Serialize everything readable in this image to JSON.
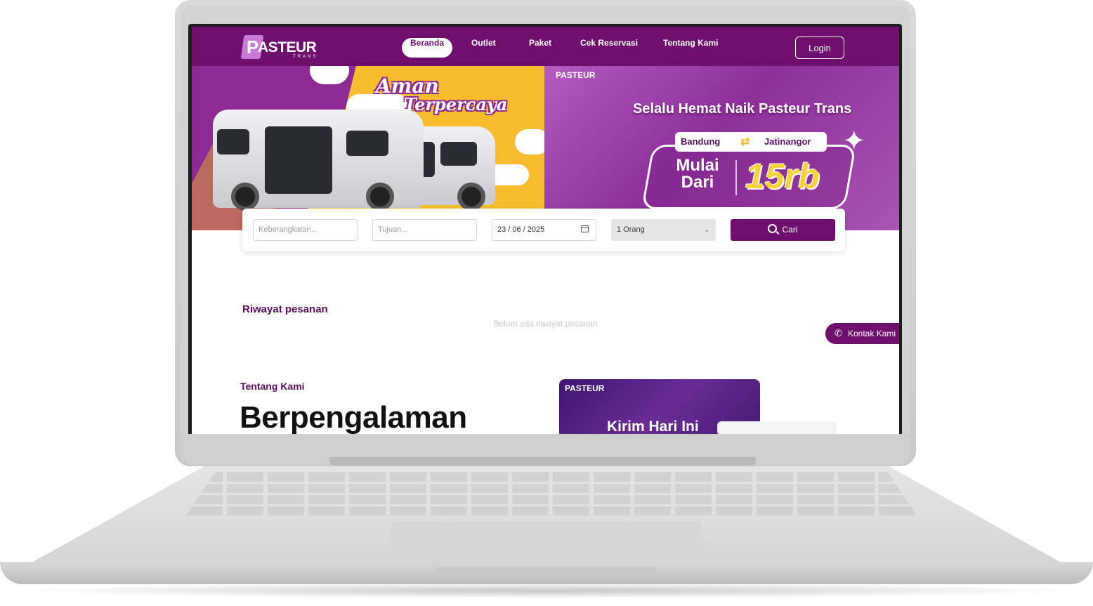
{
  "brand": {
    "name": "ASTEUR",
    "mark": "P",
    "tagline": "TRANS"
  },
  "nav": {
    "items": [
      {
        "label": "Beranda",
        "active": true
      },
      {
        "label": "Outlet"
      },
      {
        "label": "Paket"
      },
      {
        "label": "Cek Reservasi"
      },
      {
        "label": "Tentang Kami"
      }
    ],
    "login_label": "Login"
  },
  "hero": {
    "left": {
      "line1": "Aman",
      "line2": "Terpercaya"
    },
    "right": {
      "headline": "Selalu Hemat Naik Pasteur Trans",
      "origin": "Bandung",
      "destination": "Jatinangor",
      "price_prefix": "Mulai Dari",
      "price": "15rb"
    }
  },
  "search": {
    "origin_placeholder": "Keberangkatan...",
    "destination_placeholder": "Tujuan...",
    "date_value": "23 / 06 / 2025",
    "passengers_value": "1 Orang",
    "submit_label": "Cari"
  },
  "history": {
    "title": "Riwayat pesanan",
    "empty_text": "Belum ada riwayat pesanan"
  },
  "contact": {
    "label": "Kontak Kami"
  },
  "about": {
    "label": "Tentang Kami",
    "heading": "Berpengalaman",
    "promo_text": "Kirim Hari Ini"
  },
  "colors": {
    "primary": "#6e0f6e",
    "accent": "#f7bd2e",
    "hero_purple": "#8e2f9b"
  }
}
